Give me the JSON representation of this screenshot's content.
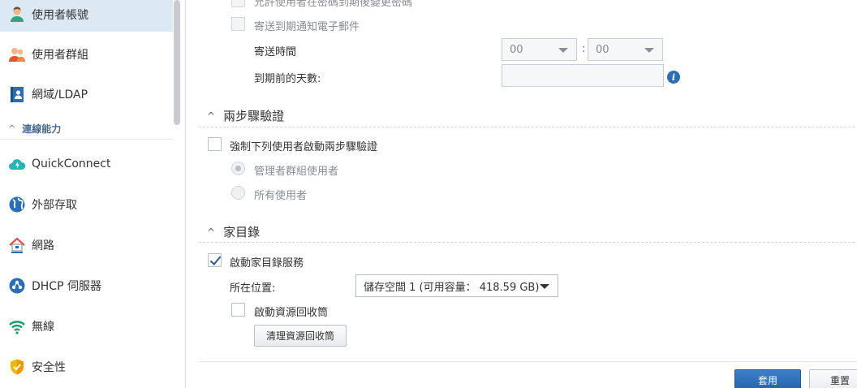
{
  "sidebar": {
    "items": [
      {
        "label": "使用者帳號",
        "icon": "user-icon"
      },
      {
        "label": "使用者群組",
        "icon": "user-group-icon"
      },
      {
        "label": "網域/LDAP",
        "icon": "domain-ldap-icon"
      },
      {
        "label": "QuickConnect",
        "icon": "quickconnect-cloud-icon"
      },
      {
        "label": "外部存取",
        "icon": "external-access-globe-icon"
      },
      {
        "label": "網路",
        "icon": "network-house-icon"
      },
      {
        "label": "DHCP 伺服器",
        "icon": "dhcp-server-icon"
      },
      {
        "label": "無線",
        "icon": "wifi-icon"
      },
      {
        "label": "安全性",
        "icon": "shield-icon"
      }
    ],
    "section": {
      "label": "連線能力"
    }
  },
  "password_expiry": {
    "allow_change_label": "允許使用者在密碼到期後變更密碼",
    "send_notice_label": "寄送到期通知電子郵件",
    "send_time_label": "寄送時間",
    "hour_value": "00",
    "minute_value": "00",
    "time_separator": ":",
    "days_before_label": "到期前的天數:",
    "days_before_value": ""
  },
  "two_step": {
    "title": "兩步驟驗證",
    "enforce_label": "強制下列使用者啟動兩步驟驗證",
    "admin_group_label": "管理者群組使用者",
    "all_users_label": "所有使用者"
  },
  "home": {
    "title": "家目錄",
    "enable_label": "啟動家目錄服務",
    "location_label": "所在位置:",
    "location_value": "儲存空間 1 (可用容量： 418.59 GB)",
    "recycle_label": "啟動資源回收筒",
    "clear_recycle_label": "清理資源回收筒"
  },
  "footer": {
    "apply_label": "套用",
    "reset_label": "重置"
  },
  "colors": {
    "accent": "#2562aa",
    "active_row": "#dde8f5",
    "info": "#2d6db5"
  }
}
